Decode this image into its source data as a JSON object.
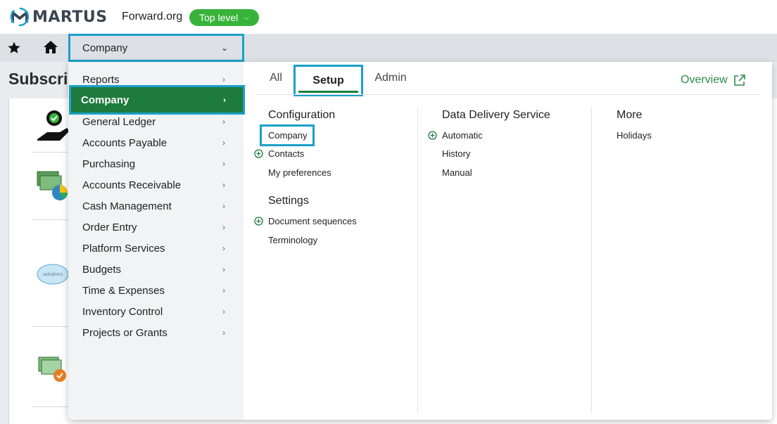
{
  "header": {
    "logo_text": "MARTUS",
    "org": "Forward.org",
    "level": "Top level"
  },
  "nav": {
    "company_label": "Company"
  },
  "background": {
    "title": "Subscri"
  },
  "menu": {
    "items": [
      {
        "label": "Reports"
      },
      {
        "label": "Company"
      },
      {
        "label": "General Ledger"
      },
      {
        "label": "Accounts Payable"
      },
      {
        "label": "Purchasing"
      },
      {
        "label": "Accounts Receivable"
      },
      {
        "label": "Cash Management"
      },
      {
        "label": "Order Entry"
      },
      {
        "label": "Platform Services"
      },
      {
        "label": "Budgets"
      },
      {
        "label": "Time & Expenses"
      },
      {
        "label": "Inventory Control"
      },
      {
        "label": "Projects or Grants"
      }
    ],
    "active_item": "Company",
    "tabs": {
      "all": "All",
      "setup": "Setup",
      "admin": "Admin"
    },
    "overview": "Overview",
    "columns": {
      "configuration": {
        "heading": "Configuration",
        "links": {
          "company": "Company",
          "contacts": "Contacts",
          "preferences": "My preferences"
        }
      },
      "settings": {
        "heading": "Settings",
        "links": {
          "sequences": "Document sequences",
          "terminology": "Terminology"
        }
      },
      "dds": {
        "heading": "Data Delivery Service",
        "links": {
          "automatic": "Automatic",
          "history": "History",
          "manual": "Manual"
        }
      },
      "more": {
        "heading": "More",
        "links": {
          "holidays": "Holidays"
        }
      }
    }
  },
  "colors": {
    "accent_green": "#1e7b3e",
    "pill_green": "#37b33a",
    "highlight_box": "#1aa0c8",
    "link_green": "#2e8b4a"
  }
}
